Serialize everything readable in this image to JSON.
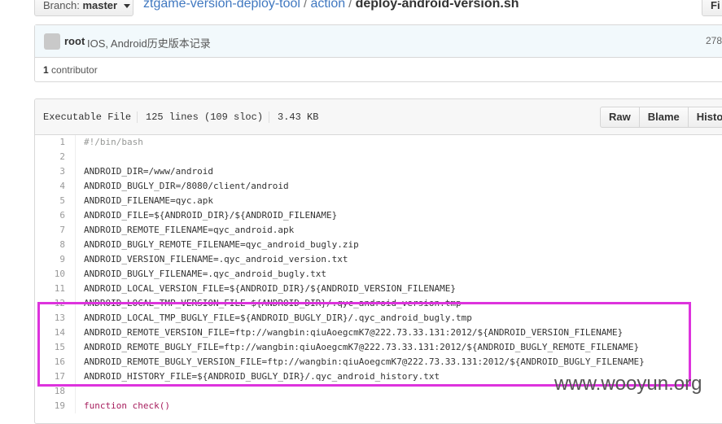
{
  "branch": {
    "prefix": "Branch:",
    "name": "master"
  },
  "breadcrumb": {
    "repo": "ztgame-version-deploy-tool",
    "sep": "/",
    "folder": "action",
    "file": "deploy-android-version.sh"
  },
  "find_label": "Fi",
  "commit": {
    "author": "root",
    "message": "IOS, Android历史版本记录",
    "sha": "278"
  },
  "contributors": {
    "count": "1",
    "label": "contributor"
  },
  "file_info": {
    "type": "Executable File",
    "lines": "125 lines (109 sloc)",
    "size": "3.43 KB"
  },
  "buttons": {
    "raw": "Raw",
    "blame": "Blame",
    "history": "History"
  },
  "code_lines": [
    {
      "n": "1",
      "text": "#!/bin/bash",
      "style": "comment"
    },
    {
      "n": "2",
      "text": "",
      "style": ""
    },
    {
      "n": "3",
      "text": "ANDROID_DIR=/www/android",
      "style": ""
    },
    {
      "n": "4",
      "text": "ANDROID_BUGLY_DIR=/8080/client/android",
      "style": ""
    },
    {
      "n": "5",
      "text": "ANDROID_FILENAME=qyc.apk",
      "style": ""
    },
    {
      "n": "6",
      "text": "ANDROID_FILE=${ANDROID_DIR}/${ANDROID_FILENAME}",
      "style": ""
    },
    {
      "n": "7",
      "text": "ANDROID_REMOTE_FILENAME=qyc_android.apk",
      "style": ""
    },
    {
      "n": "8",
      "text": "ANDROID_BUGLY_REMOTE_FILENAME=qyc_android_bugly.zip",
      "style": ""
    },
    {
      "n": "9",
      "text": "ANDROID_VERSION_FILENAME=.qyc_android_version.txt",
      "style": ""
    },
    {
      "n": "10",
      "text": "ANDROID_BUGLY_FILENAME=.qyc_android_bugly.txt",
      "style": ""
    },
    {
      "n": "11",
      "text": "ANDROID_LOCAL_VERSION_FILE=${ANDROID_DIR}/${ANDROID_VERSION_FILENAME}",
      "style": ""
    },
    {
      "n": "12",
      "text": "ANDROID_LOCAL_TMP_VERSION_FILE=${ANDROID_DIR}/.qyc_android_version.tmp",
      "style": ""
    },
    {
      "n": "13",
      "text": "ANDROID_LOCAL_TMP_BUGLY_FILE=${ANDROID_BUGLY_DIR}/.qyc_android_bugly.tmp",
      "style": ""
    },
    {
      "n": "14",
      "text": "ANDROID_REMOTE_VERSION_FILE=ftp://wangbin:qiuAoegcmK7@222.73.33.131:2012/${ANDROID_VERSION_FILENAME}",
      "style": ""
    },
    {
      "n": "15",
      "text": "ANDROID_REMOTE_BUGLY_FILE=ftp://wangbin:qiuAoegcmK7@222.73.33.131:2012/${ANDROID_BUGLY_REMOTE_FILENAME}",
      "style": ""
    },
    {
      "n": "16",
      "text": "ANDROID_REMOTE_BUGLY_VERSION_FILE=ftp://wangbin:qiuAoegcmK7@222.73.33.131:2012/${ANDROID_BUGLY_FILENAME}",
      "style": ""
    },
    {
      "n": "17",
      "text": "ANDROID_HISTORY_FILE=${ANDROID_BUGLY_DIR}/.qyc_android_history.txt",
      "style": ""
    },
    {
      "n": "18",
      "text": "",
      "style": ""
    },
    {
      "n": "19",
      "text": "function check()",
      "style": "kw"
    }
  ],
  "highlight_color": "#dd33dd",
  "watermark": "www.wooyun.org"
}
